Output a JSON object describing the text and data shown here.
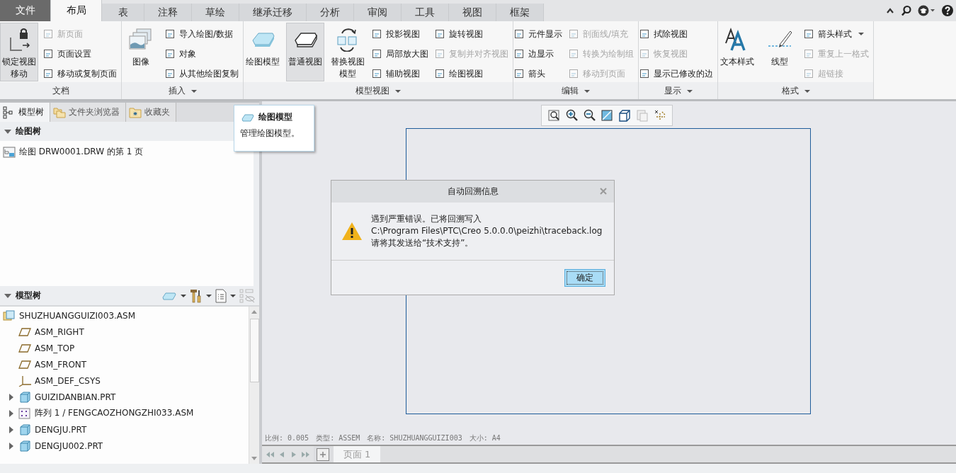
{
  "tabs": [
    {
      "label": "文件",
      "kind": "file",
      "selected": false
    },
    {
      "label": "布局",
      "kind": "tab",
      "selected": true
    },
    {
      "label": "表",
      "kind": "tab",
      "selected": false
    },
    {
      "label": "注释",
      "kind": "tab",
      "selected": false
    },
    {
      "label": "草绘",
      "kind": "tab",
      "selected": false
    },
    {
      "label": "继承迁移",
      "kind": "tab",
      "selected": false
    },
    {
      "label": "分析",
      "kind": "tab",
      "selected": false
    },
    {
      "label": "审阅",
      "kind": "tab",
      "selected": false
    },
    {
      "label": "工具",
      "kind": "tab",
      "selected": false
    },
    {
      "label": "视图",
      "kind": "tab",
      "selected": false
    },
    {
      "label": "框架",
      "kind": "tab",
      "selected": false
    }
  ],
  "ribbon": {
    "groups": [
      {
        "label": "文档",
        "has_menu": false,
        "columns": [
          {
            "kind": "large",
            "label": "锁定视图移动",
            "selected": true
          },
          {
            "kind": "stack",
            "items": [
              {
                "label": "新页面",
                "disabled": true
              },
              {
                "label": "页面设置",
                "disabled": false
              },
              {
                "label": "移动或复制页面",
                "disabled": false
              }
            ]
          }
        ]
      },
      {
        "label": "插入",
        "has_menu": true,
        "columns": [
          {
            "kind": "large",
            "label": "图像",
            "selected": false
          },
          {
            "kind": "stack",
            "items": [
              {
                "label": "导入绘图/数据",
                "disabled": false
              },
              {
                "label": "对象",
                "disabled": false
              },
              {
                "label": "从其他绘图复制",
                "disabled": false
              }
            ]
          }
        ]
      },
      {
        "label": "模型视图",
        "has_menu": true,
        "columns": [
          {
            "kind": "large",
            "label": "绘图模型",
            "selected": false
          },
          {
            "kind": "large",
            "label": "普通视图",
            "selected": true
          },
          {
            "kind": "large",
            "label": "替换视图模型",
            "selected": false
          },
          {
            "kind": "stack",
            "items": [
              {
                "label": "投影视图",
                "disabled": false
              },
              {
                "label": "局部放大图",
                "disabled": false
              },
              {
                "label": "辅助视图",
                "disabled": false
              }
            ]
          },
          {
            "kind": "stack",
            "items": [
              {
                "label": "旋转视图",
                "disabled": false
              },
              {
                "label": "复制并对齐视图",
                "disabled": true
              },
              {
                "label": "绘图视图",
                "disabled": false
              }
            ]
          }
        ]
      },
      {
        "label": "编辑",
        "has_menu": true,
        "columns": [
          {
            "kind": "stack",
            "items": [
              {
                "label": "元件显示",
                "disabled": false
              },
              {
                "label": "边显示",
                "disabled": false
              },
              {
                "label": "箭头",
                "disabled": false
              }
            ]
          },
          {
            "kind": "stack",
            "items": [
              {
                "label": "剖面线/填充",
                "disabled": true
              },
              {
                "label": "转换为绘制组",
                "disabled": true
              },
              {
                "label": "移动到页面",
                "disabled": true
              }
            ]
          }
        ]
      },
      {
        "label": "显示",
        "has_menu": true,
        "columns": [
          {
            "kind": "stack",
            "items": [
              {
                "label": "拭除视图",
                "disabled": false
              },
              {
                "label": "恢复视图",
                "disabled": true
              },
              {
                "label": "显示已修改的边",
                "disabled": false
              }
            ]
          }
        ]
      },
      {
        "label": "格式",
        "has_menu": true,
        "columns": [
          {
            "kind": "large",
            "label": "文本样式",
            "selected": false
          },
          {
            "kind": "large",
            "label": "线型",
            "selected": false
          },
          {
            "kind": "stack",
            "items": [
              {
                "label": "箭头样式",
                "disabled": false,
                "has_menu": true
              },
              {
                "label": "重复上一格式",
                "disabled": true
              },
              {
                "label": "超链接",
                "disabled": true
              }
            ]
          }
        ]
      }
    ]
  },
  "tooltip": {
    "title": "绘图模型",
    "text": "管理绘图模型。"
  },
  "navigator": {
    "tabs": [
      {
        "label": "模型树",
        "kind": "tree",
        "selected": true
      },
      {
        "label": "文件夹浏览器",
        "kind": "folders",
        "selected": false
      },
      {
        "label": "收藏夹",
        "kind": "favorites",
        "selected": false
      }
    ],
    "drawing_tree": {
      "title": "绘图树",
      "expanded": true,
      "items": [
        {
          "label": "绘图 DRW0001.DRW 的第 1 页"
        }
      ]
    },
    "model_tree": {
      "title": "模型树",
      "expanded": true,
      "items": [
        {
          "label": "SHUZHUANGGUIZI003.ASM",
          "kind": "assembly",
          "children": [
            {
              "label": "ASM_RIGHT",
              "kind": "plane"
            },
            {
              "label": "ASM_TOP",
              "kind": "plane"
            },
            {
              "label": "ASM_FRONT",
              "kind": "plane"
            },
            {
              "label": "ASM_DEF_CSYS",
              "kind": "csys"
            },
            {
              "label": "GUIZIDANBIAN.PRT",
              "kind": "part",
              "expanded": false
            },
            {
              "label": "阵列 1 / FENGCAOZHONGZHI033.ASM",
              "kind": "pattern",
              "expanded": false
            },
            {
              "label": "DENGJU.PRT",
              "kind": "part",
              "expanded": false
            },
            {
              "label": "DENGJU002.PRT",
              "kind": "part",
              "expanded": false
            }
          ]
        }
      ]
    }
  },
  "dialog": {
    "title": "自动回溯信息",
    "lines": [
      "遇到严重错误。已将回溯写入",
      "C:\\Program Files\\PTC\\Creo 5.0.0.0\\peizhi\\traceback.log",
      "请将其发送给“技术支持”。"
    ],
    "button": "确定"
  },
  "sheet_info": [
    "比例: 0.005",
    "类型: ASSEM",
    "名称: SHUZHUANGGUIZI003",
    "大小: A4"
  ],
  "pages": [
    {
      "label": "页面 1",
      "selected": true
    }
  ]
}
